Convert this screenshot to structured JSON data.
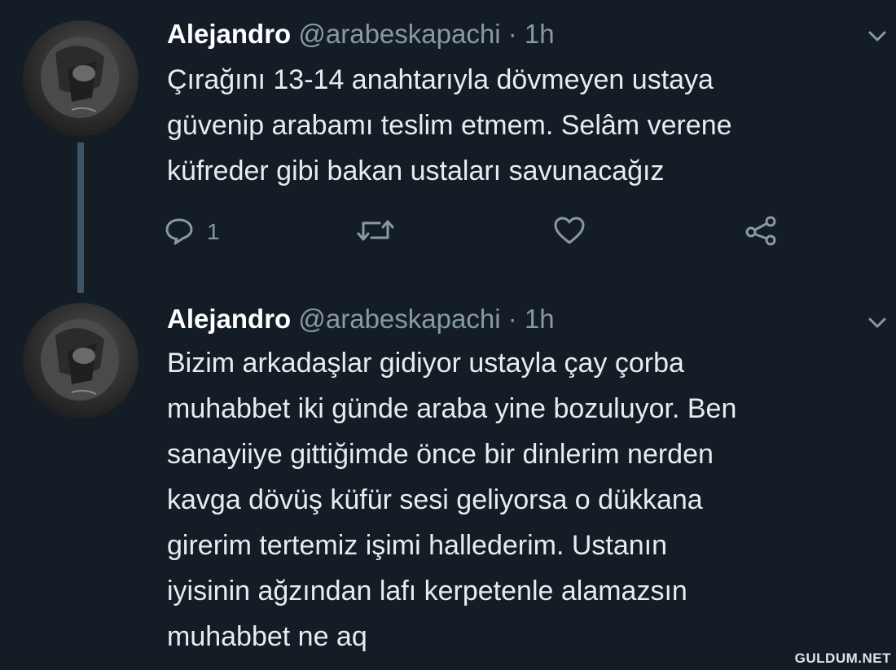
{
  "thread": {
    "tweets": [
      {
        "author_name": "Alejandro",
        "handle": "@arabeskapachi",
        "separator": "·",
        "time": "1h",
        "text_lines": [
          "Çırağını 13-14 anahtarıyla dövmeyen ustaya",
          "güvenip arabamı teslim etmem. Selâm verene",
          "küfreder gibi bakan ustaları savunacağız"
        ],
        "reply_count": "1"
      },
      {
        "author_name": "Alejandro",
        "handle": "@arabeskapachi",
        "separator": "·",
        "time": "1h",
        "text_lines": [
          "Bizim arkadaşlar gidiyor ustayla çay çorba",
          "muhabbet iki günde araba yine bozuluyor. Ben",
          "sanayiiye gittiğimde önce bir dinlerim nerden",
          "kavga dövüş küfür sesi geliyorsa o dükkana",
          "girerim tertemiz işimi hallederim. Ustanın",
          "iyisinin ağzından lafı kerpetenle alamazsın",
          "muhabbet ne aq"
        ]
      }
    ]
  },
  "icons": {
    "reply": "reply-icon",
    "retweet": "retweet-icon",
    "like": "heart-icon",
    "share": "share-icon",
    "menu": "chevron-down-icon"
  },
  "colors": {
    "background": "#141d26",
    "secondary_text": "#8899a6",
    "thread_line": "#3d5466"
  },
  "watermark": "GULDUM.NET"
}
